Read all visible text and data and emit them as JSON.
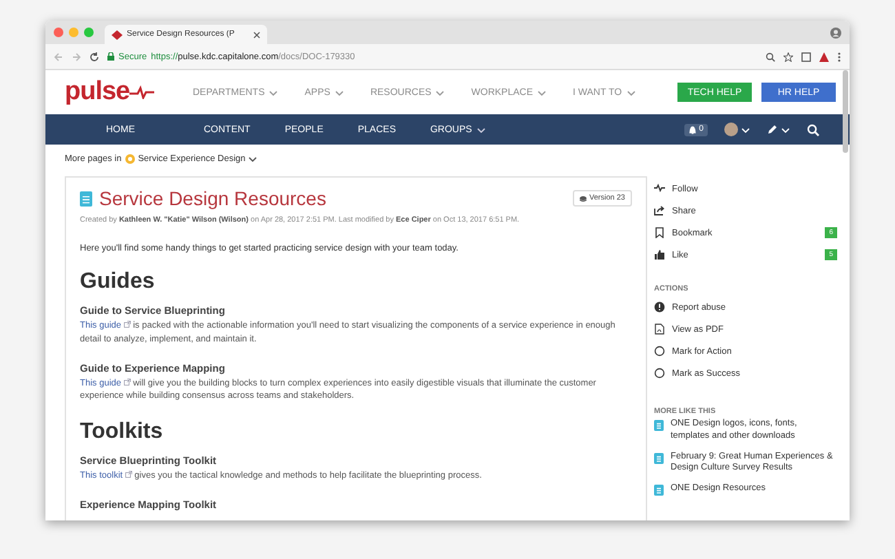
{
  "browser": {
    "tab_title": "Service Design Resources (P",
    "secure_label": "Secure",
    "url_scheme": "https://",
    "url_host": "pulse.kdc.capitalone.com",
    "url_path": "/docs/DOC-179330"
  },
  "header": {
    "logo": "pulse",
    "menu": [
      {
        "label": "DEPARTMENTS"
      },
      {
        "label": "APPS"
      },
      {
        "label": "RESOURCES"
      },
      {
        "label": "WORKPLACE"
      },
      {
        "label": "I WANT TO"
      }
    ],
    "buttons": [
      {
        "label": "TECH HELP",
        "color": "#2aa84a"
      },
      {
        "label": "HR HELP",
        "color": "#3f6fcc"
      }
    ]
  },
  "nav": {
    "items": [
      {
        "label": "HOME",
        "dropdown": false
      },
      {
        "label": "CONTENT",
        "dropdown": false
      },
      {
        "label": "PEOPLE",
        "dropdown": false
      },
      {
        "label": "PLACES",
        "dropdown": false
      },
      {
        "label": "GROUPS",
        "dropdown": true
      }
    ],
    "notification_count": "0"
  },
  "breadcrumb": {
    "prefix": "More pages in",
    "place": "Service Experience Design"
  },
  "document": {
    "title": "Service Design Resources",
    "version": "Version 23",
    "meta": "Created by **Kathleen W. \"Katie\" Wilson (Wilson)** on Apr 28, 2017 2:51 PM. Last modified by **Ece Ciper** on Oct 13, 2017 6:51 PM.",
    "intro": "Here you'll find some handy things to get started practicing service design with your team today.",
    "sections": [
      {
        "heading": "Guides",
        "items": [
          {
            "title": "Guide to Service Blueprinting",
            "link": "This guide",
            "text": " is packed with the actionable information you'll need to start visualizing the components of a service experience in enough detail to analyze, implement, and maintain it."
          },
          {
            "title": "Guide to Experience Mapping",
            "link": "This guide",
            "text": " will give you the building blocks to turn complex experiences into easily digestible visuals that illuminate the customer experience while building consensus across teams and stakeholders."
          }
        ]
      },
      {
        "heading": "Toolkits",
        "items": [
          {
            "title": "Service Blueprinting Toolkit",
            "link": "This toolkit",
            "text": " gives you the tactical knowledge and methods to help facilitate the blueprinting process."
          },
          {
            "title": "Experience Mapping Toolkit"
          }
        ]
      }
    ]
  },
  "sidebar": {
    "social": [
      {
        "kind": "follow",
        "label": "Follow"
      },
      {
        "kind": "share",
        "label": "Share"
      },
      {
        "kind": "bookmark",
        "label": "Bookmark",
        "count": "6"
      },
      {
        "kind": "like",
        "label": "Like",
        "count": "5"
      }
    ],
    "actions": {
      "heading": "ACTIONS",
      "items": [
        {
          "kind": "report",
          "label": "Report abuse"
        },
        {
          "kind": "pdf",
          "label": "View as PDF"
        },
        {
          "kind": "mark",
          "label": "Mark for Action"
        },
        {
          "kind": "mark",
          "label": "Mark as Success"
        }
      ]
    },
    "more": {
      "heading": "MORE LIKE THIS",
      "items": [
        {
          "label": "ONE Design logos, icons, fonts, templates and other downloads"
        },
        {
          "label": "February 9: Great Human Experiences & Design Culture Survey Results"
        },
        {
          "label": "ONE Design Resources"
        }
      ]
    }
  }
}
